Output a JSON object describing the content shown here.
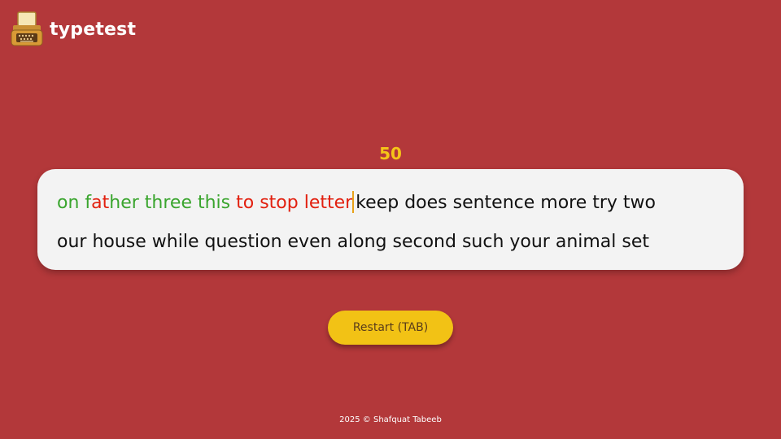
{
  "app": {
    "title": "typetest",
    "logo_icon": "typewriter-icon"
  },
  "timer": {
    "value": "50"
  },
  "typing_text": {
    "lines": [
      [
        {
          "text": "on f",
          "state": "correct"
        },
        {
          "text": "at",
          "state": "incorrect"
        },
        {
          "text": "her three this",
          "state": "correct"
        },
        {
          "text": " ",
          "state": "correct"
        },
        {
          "text": "to stop letter",
          "state": "incorrect"
        },
        {
          "text": "",
          "state": "caret"
        },
        {
          "text": "keep does sentence more try two",
          "state": "pending"
        }
      ],
      [
        {
          "text": "our house while question even along second such your animal set",
          "state": "pending"
        }
      ]
    ]
  },
  "restart": {
    "label": "Restart (TAB)"
  },
  "footer": {
    "text": "2025 © Shafquat Tabeeb"
  },
  "colors": {
    "background": "#b3383a",
    "correct": "#3aa52e",
    "incorrect": "#e2200f",
    "pending": "#111111",
    "accent": "#f2c215",
    "timer": "#f5c518",
    "caret": "#e8a21a"
  }
}
